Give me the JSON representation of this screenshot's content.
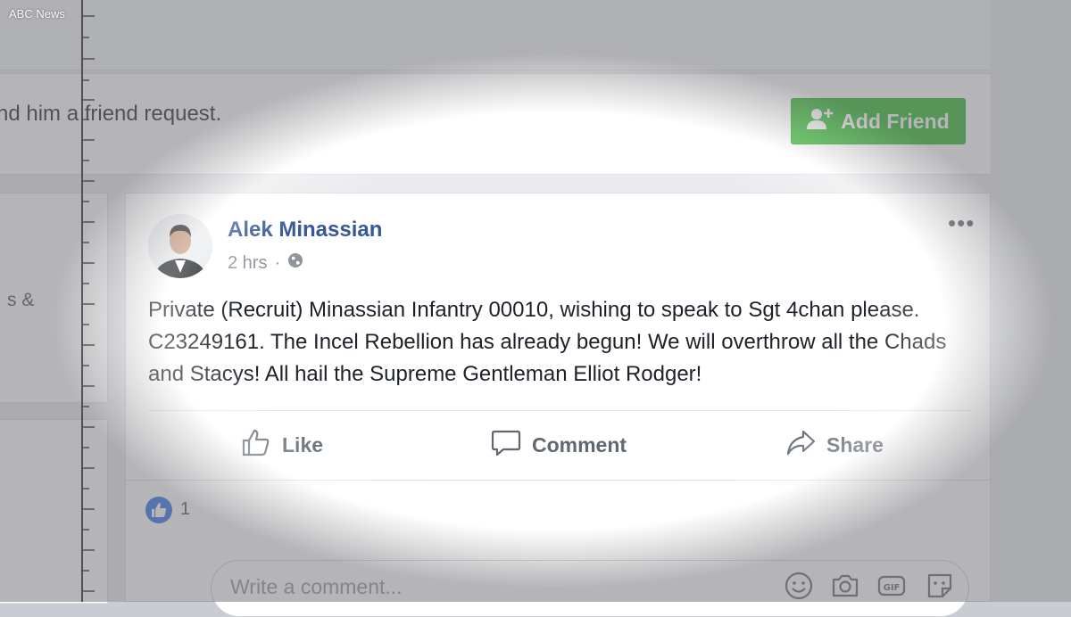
{
  "watermark": "ABC News",
  "friend_request": {
    "text": "nd him a friend request.",
    "button_label": "Add Friend"
  },
  "left_column": {
    "fragment": "s &"
  },
  "post": {
    "author": "Alek Minassian",
    "time": "2 hrs",
    "audience_icon": "globe-icon",
    "body": "Private (Recruit) Minassian Infantry 00010, wishing to speak to Sgt 4chan please. C23249161. The Incel Rebellion has already begun! We will overthrow all the Chads and Stacys! All hail the Supreme Gentleman Elliot Rodger!",
    "actions": {
      "like": "Like",
      "comment": "Comment",
      "share": "Share"
    },
    "reactions": {
      "icon": "thumbs-up-icon",
      "count": "1"
    },
    "comment_input": {
      "placeholder": "Write a comment...",
      "icons": [
        "emoji-icon",
        "camera-icon",
        "gif-icon",
        "sticker-icon"
      ]
    }
  },
  "colors": {
    "accent_green": "#2fb52c",
    "link_blue": "#365899",
    "like_blue": "#2d70e8"
  }
}
